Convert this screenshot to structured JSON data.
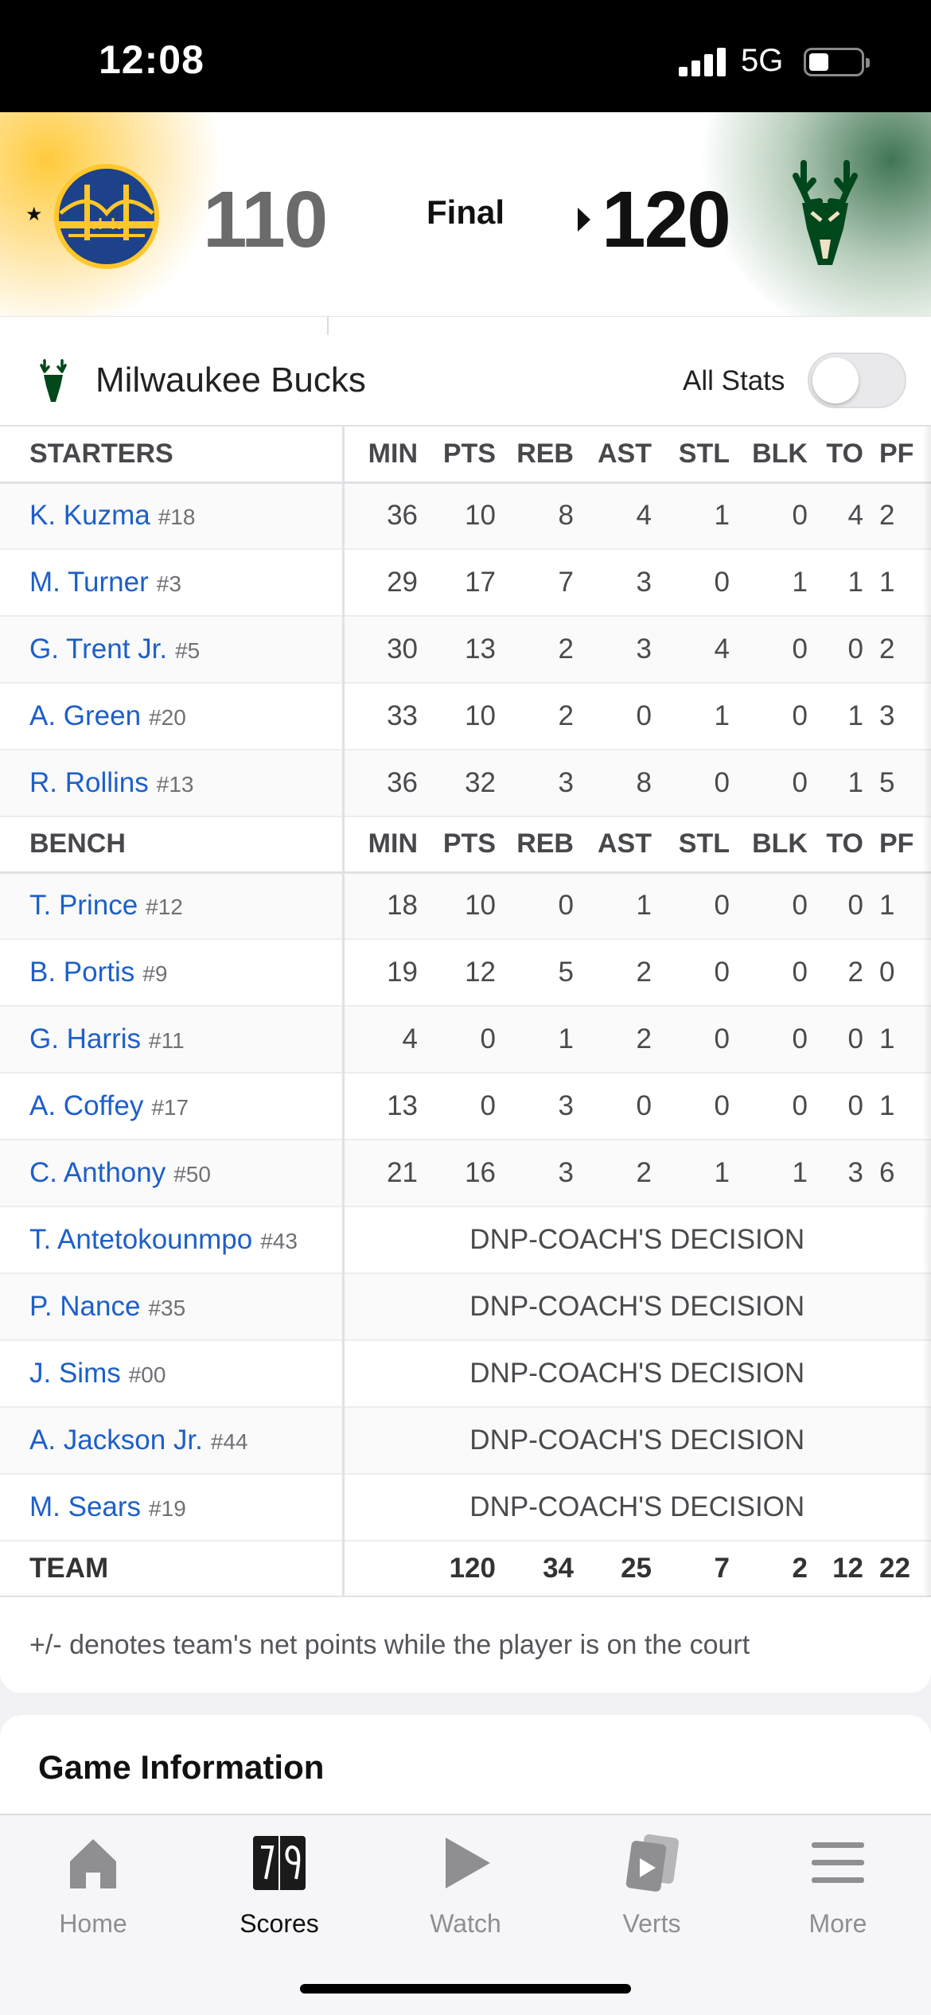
{
  "status_bar": {
    "time": "12:08",
    "network": "5G"
  },
  "game": {
    "away": {
      "name": "Golden State Warriors",
      "score": "110",
      "logo": "warriors-logo"
    },
    "home": {
      "name": "Milwaukee Bucks",
      "score": "120",
      "logo": "bucks-logo"
    },
    "status": "Final",
    "winner_marker": "★"
  },
  "boxscore": {
    "team_name": "Milwaukee Bucks",
    "all_stats_label": "All Stats",
    "all_stats_on": false,
    "columns": [
      "MIN",
      "PTS",
      "REB",
      "AST",
      "STL",
      "BLK",
      "TO",
      "PF"
    ],
    "starters_label": "STARTERS",
    "bench_label": "BENCH",
    "team_label": "TEAM",
    "starters": [
      {
        "name": "K. Kuzma",
        "jersey": "#18",
        "stats": [
          "36",
          "10",
          "8",
          "4",
          "1",
          "0",
          "4",
          "2"
        ]
      },
      {
        "name": "M. Turner",
        "jersey": "#3",
        "stats": [
          "29",
          "17",
          "7",
          "3",
          "0",
          "1",
          "1",
          "1"
        ]
      },
      {
        "name": "G. Trent Jr.",
        "jersey": "#5",
        "stats": [
          "30",
          "13",
          "2",
          "3",
          "4",
          "0",
          "0",
          "2"
        ]
      },
      {
        "name": "A. Green",
        "jersey": "#20",
        "stats": [
          "33",
          "10",
          "2",
          "0",
          "1",
          "0",
          "1",
          "3"
        ]
      },
      {
        "name": "R. Rollins",
        "jersey": "#13",
        "stats": [
          "36",
          "32",
          "3",
          "8",
          "0",
          "0",
          "1",
          "5"
        ]
      }
    ],
    "bench": [
      {
        "name": "T. Prince",
        "jersey": "#12",
        "stats": [
          "18",
          "10",
          "0",
          "1",
          "0",
          "0",
          "0",
          "1"
        ]
      },
      {
        "name": "B. Portis",
        "jersey": "#9",
        "stats": [
          "19",
          "12",
          "5",
          "2",
          "0",
          "0",
          "2",
          "0"
        ]
      },
      {
        "name": "G. Harris",
        "jersey": "#11",
        "stats": [
          "4",
          "0",
          "1",
          "2",
          "0",
          "0",
          "0",
          "1"
        ]
      },
      {
        "name": "A. Coffey",
        "jersey": "#17",
        "stats": [
          "13",
          "0",
          "3",
          "0",
          "0",
          "0",
          "0",
          "1"
        ]
      },
      {
        "name": "C. Anthony",
        "jersey": "#50",
        "stats": [
          "21",
          "16",
          "3",
          "2",
          "1",
          "1",
          "3",
          "6"
        ]
      },
      {
        "name": "T. Antetokounmpo",
        "jersey": "#43",
        "dnp": "DNP-COACH'S DECISION"
      },
      {
        "name": "P. Nance",
        "jersey": "#35",
        "dnp": "DNP-COACH'S DECISION"
      },
      {
        "name": "J. Sims",
        "jersey": "#00",
        "dnp": "DNP-COACH'S DECISION"
      },
      {
        "name": "A. Jackson Jr.",
        "jersey": "#44",
        "dnp": "DNP-COACH'S DECISION"
      },
      {
        "name": "M. Sears",
        "jersey": "#19",
        "dnp": "DNP-COACH'S DECISION"
      }
    ],
    "team_totals": [
      "",
      "120",
      "34",
      "25",
      "7",
      "2",
      "12",
      "22"
    ],
    "footnote": "+/- denotes team's net points while the player is on the court"
  },
  "game_information": {
    "title": "Game Information"
  },
  "tabbar": {
    "active": "Scores",
    "items": [
      {
        "label": "Home",
        "icon": "home-icon"
      },
      {
        "label": "Scores",
        "icon": "scoreboard-icon"
      },
      {
        "label": "Watch",
        "icon": "play-icon"
      },
      {
        "label": "Verts",
        "icon": "verts-icon"
      },
      {
        "label": "More",
        "icon": "menu-icon"
      }
    ]
  },
  "colors": {
    "link": "#1d5fc9",
    "warriors_gold": "#ffc72c",
    "warriors_blue": "#1d428a",
    "bucks_green": "#00471b"
  }
}
